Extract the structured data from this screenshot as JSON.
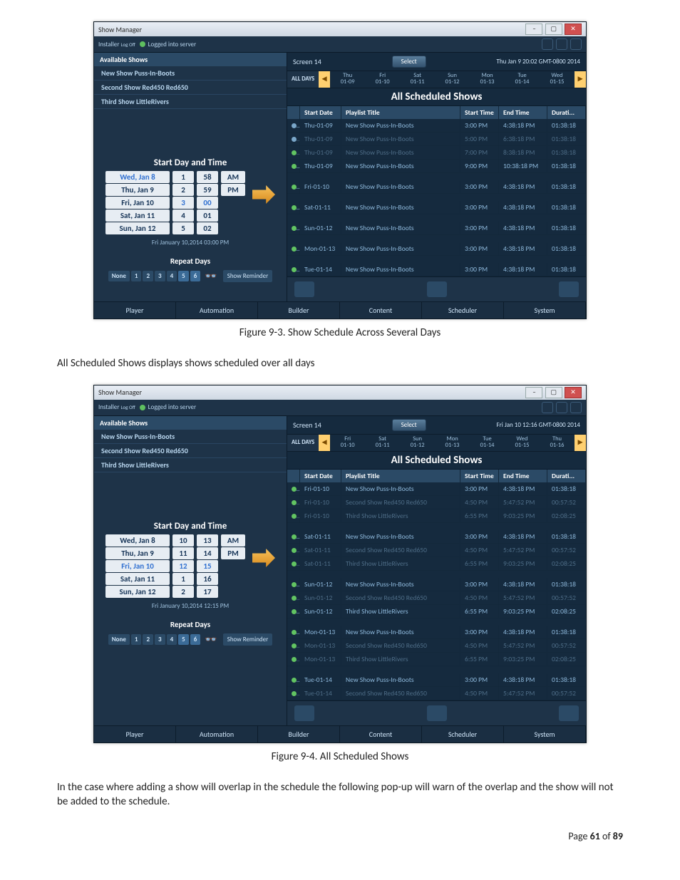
{
  "doc": {
    "fig1_caption": "Figure 9-3.  Show Schedule Across Several Days",
    "para1": "All Scheduled Shows displays shows scheduled over all days",
    "fig2_caption": "Figure 9-4.  All Scheduled Shows",
    "para2": "In the case where adding a show will overlap in the schedule the following pop-up will warn of the overlap and the show will not be added to the schedule.",
    "page_prefix": "Page ",
    "page_num": "61",
    "page_of": " of ",
    "page_total": "89"
  },
  "common": {
    "app_title": "Show Manager",
    "installer": "Installer",
    "logoff": "Log Off",
    "logged": "Logged into server",
    "screen_label": "Screen 14",
    "select": "Select",
    "available_shows": "Available Shows",
    "shows": [
      "New Show Puss-In-Boots",
      "Second Show Red450 Red650",
      "Third Show LittleRivers"
    ],
    "start_day": "Start Day and Time",
    "repeat_days": "Repeat Days",
    "repeat_btns": [
      "None",
      "1",
      "2",
      "3",
      "4",
      "5",
      "6"
    ],
    "show_reminder": "Show Reminder",
    "all_days": "ALL DAYS",
    "all_scheduled": "All Scheduled Shows",
    "cols": {
      "start_date": "Start Date",
      "playlist": "Playlist Title",
      "start_time": "Start Time",
      "end_time": "End Time",
      "duration": "Durati..."
    },
    "tabs": [
      "Player",
      "Automation",
      "Builder",
      "Content",
      "Scheduler",
      "System"
    ]
  },
  "fig1": {
    "timestamp": "Thu Jan 9 20:02 GMT-0800 2014",
    "days": [
      {
        "d": "Thu",
        "s": "01-09"
      },
      {
        "d": "Fri",
        "s": "01-10"
      },
      {
        "d": "Sat",
        "s": "01-11"
      },
      {
        "d": "Sun",
        "s": "01-12"
      },
      {
        "d": "Mon",
        "s": "01-13"
      },
      {
        "d": "Tue",
        "s": "01-14"
      },
      {
        "d": "Wed",
        "s": "01-15"
      }
    ],
    "picker": {
      "wdays": [
        "Wed, Jan 8",
        "Thu, Jan 9",
        "Fri, Jan 10",
        "Sat, Jan 11",
        "Sun, Jan 12"
      ],
      "sel_wday": 0,
      "nums": [
        "1",
        "2",
        "3",
        "4",
        "5"
      ],
      "mins": [
        "58",
        "59",
        "00",
        "01",
        "02"
      ],
      "ampm": [
        "AM",
        "PM"
      ],
      "footer": "Fri January 10,2014 03:00 PM"
    },
    "rows": [
      {
        "g": 0,
        "dim": false,
        "dot": "wait",
        "date": "Thu-01-09",
        "title": "New Show Puss-In-Boots",
        "start": "3:00 PM",
        "end": "4:38:18 PM",
        "dur": "01:38:18"
      },
      {
        "g": 0,
        "dim": true,
        "dot": "wait",
        "date": "Thu-01-09",
        "title": "New Show Puss-In-Boots",
        "start": "5:00 PM",
        "end": "6:38:18 PM",
        "dur": "01:38:18"
      },
      {
        "g": 0,
        "dim": true,
        "dot": "ok",
        "date": "Thu-01-09",
        "title": "New Show Puss-In-Boots",
        "start": "7:00 PM",
        "end": "8:38:18 PM",
        "dur": "01:38:18"
      },
      {
        "g": 0,
        "dim": false,
        "dot": "ok",
        "date": "Thu-01-09",
        "title": "New Show Puss-In-Boots",
        "start": "9:00 PM",
        "end": "10:38:18 PM",
        "dur": "01:38:18"
      },
      {
        "g": 1,
        "dim": false,
        "dot": "ok",
        "date": "Fri-01-10",
        "title": "New Show Puss-In-Boots",
        "start": "3:00 PM",
        "end": "4:38:18 PM",
        "dur": "01:38:18"
      },
      {
        "g": 2,
        "dim": false,
        "dot": "ok",
        "date": "Sat-01-11",
        "title": "New Show Puss-In-Boots",
        "start": "3:00 PM",
        "end": "4:38:18 PM",
        "dur": "01:38:18"
      },
      {
        "g": 3,
        "dim": false,
        "dot": "ok",
        "date": "Sun-01-12",
        "title": "New Show Puss-In-Boots",
        "start": "3:00 PM",
        "end": "4:38:18 PM",
        "dur": "01:38:18"
      },
      {
        "g": 4,
        "dim": false,
        "dot": "ok",
        "date": "Mon-01-13",
        "title": "New Show Puss-In-Boots",
        "start": "3:00 PM",
        "end": "4:38:18 PM",
        "dur": "01:38:18"
      },
      {
        "g": 5,
        "dim": false,
        "dot": "ok",
        "date": "Tue-01-14",
        "title": "New Show Puss-In-Boots",
        "start": "3:00 PM",
        "end": "4:38:18 PM",
        "dur": "01:38:18"
      }
    ]
  },
  "fig2": {
    "timestamp": "Fri Jan 10 12:16 GMT-0800 2014",
    "days": [
      {
        "d": "Fri",
        "s": "01-10"
      },
      {
        "d": "Sat",
        "s": "01-11"
      },
      {
        "d": "Sun",
        "s": "01-12"
      },
      {
        "d": "Mon",
        "s": "01-13"
      },
      {
        "d": "Tue",
        "s": "01-14"
      },
      {
        "d": "Wed",
        "s": "01-15"
      },
      {
        "d": "Thu",
        "s": "01-16"
      }
    ],
    "picker": {
      "wdays": [
        "Wed, Jan 8",
        "Thu, Jan 9",
        "Fri, Jan 10",
        "Sat, Jan 11",
        "Sun, Jan 12"
      ],
      "sel_wday": 2,
      "nums": [
        "10",
        "11",
        "12",
        "1",
        "2"
      ],
      "mins": [
        "13",
        "14",
        "15",
        "16",
        "17"
      ],
      "ampm": [
        "AM",
        "PM"
      ],
      "footer": "Fri January 10,2014 12:15 PM"
    },
    "rows": [
      {
        "g": 0,
        "dim": false,
        "dot": "ok",
        "date": "Fri-01-10",
        "title": "New Show Puss-In-Boots",
        "start": "3:00 PM",
        "end": "4:38:18 PM",
        "dur": "01:38:18"
      },
      {
        "g": 0,
        "dim": true,
        "dot": "ok",
        "date": "Fri-01-10",
        "title": "Second Show Red450 Red650",
        "start": "4:50 PM",
        "end": "5:47:52 PM",
        "dur": "00:57:52"
      },
      {
        "g": 0,
        "dim": true,
        "dot": "ok",
        "date": "Fri-01-10",
        "title": "Third Show LittleRivers",
        "start": "6:55 PM",
        "end": "9:03:25 PM",
        "dur": "02:08:25"
      },
      {
        "g": 1,
        "dim": false,
        "dot": "ok",
        "date": "Sat-01-11",
        "title": "New Show Puss-In-Boots",
        "start": "3:00 PM",
        "end": "4:38:18 PM",
        "dur": "01:38:18"
      },
      {
        "g": 1,
        "dim": true,
        "dot": "ok",
        "date": "Sat-01-11",
        "title": "Second Show Red450 Red650",
        "start": "4:50 PM",
        "end": "5:47:52 PM",
        "dur": "00:57:52"
      },
      {
        "g": 1,
        "dim": true,
        "dot": "ok",
        "date": "Sat-01-11",
        "title": "Third Show LittleRivers",
        "start": "6:55 PM",
        "end": "9:03:25 PM",
        "dur": "02:08:25"
      },
      {
        "g": 2,
        "dim": false,
        "dot": "ok",
        "date": "Sun-01-12",
        "title": "New Show Puss-In-Boots",
        "start": "3:00 PM",
        "end": "4:38:18 PM",
        "dur": "01:38:18"
      },
      {
        "g": 2,
        "dim": true,
        "dot": "ok",
        "date": "Sun-01-12",
        "title": "Second Show Red450 Red650",
        "start": "4:50 PM",
        "end": "5:47:52 PM",
        "dur": "00:57:52"
      },
      {
        "g": 2,
        "dim": false,
        "dot": "ok",
        "date": "Sun-01-12",
        "title": "Third Show LittleRivers",
        "start": "6:55 PM",
        "end": "9:03:25 PM",
        "dur": "02:08:25"
      },
      {
        "g": 3,
        "dim": false,
        "dot": "ok",
        "date": "Mon-01-13",
        "title": "New Show Puss-In-Boots",
        "start": "3:00 PM",
        "end": "4:38:18 PM",
        "dur": "01:38:18"
      },
      {
        "g": 3,
        "dim": true,
        "dot": "ok",
        "date": "Mon-01-13",
        "title": "Second Show Red450 Red650",
        "start": "4:50 PM",
        "end": "5:47:52 PM",
        "dur": "00:57:52"
      },
      {
        "g": 3,
        "dim": true,
        "dot": "ok",
        "date": "Mon-01-13",
        "title": "Third Show LittleRivers",
        "start": "6:55 PM",
        "end": "9:03:25 PM",
        "dur": "02:08:25"
      },
      {
        "g": 4,
        "dim": false,
        "dot": "ok",
        "date": "Tue-01-14",
        "title": "New Show Puss-In-Boots",
        "start": "3:00 PM",
        "end": "4:38:18 PM",
        "dur": "01:38:18"
      },
      {
        "g": 4,
        "dim": true,
        "dot": "ok",
        "date": "Tue-01-14",
        "title": "Second Show Red450 Red650",
        "start": "4:50 PM",
        "end": "5:47:52 PM",
        "dur": "00:57:52"
      }
    ]
  }
}
